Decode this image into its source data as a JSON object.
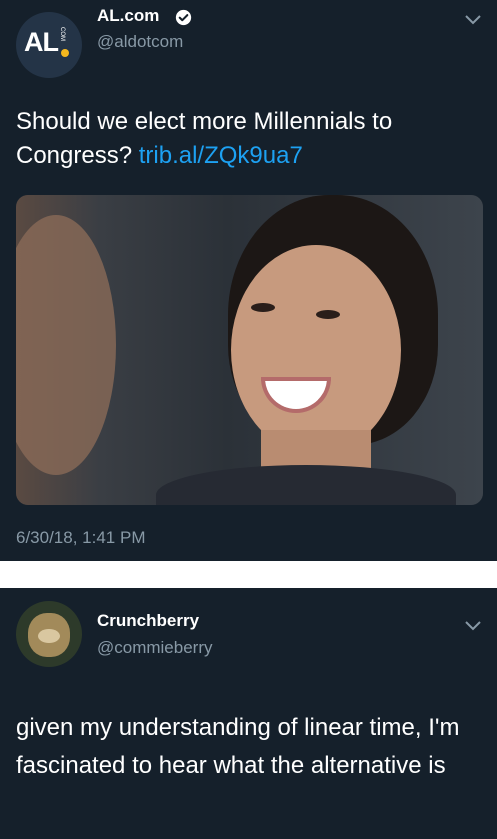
{
  "tweet1": {
    "avatar_text": "AL",
    "avatar_small_text": "COM",
    "name": "AL.com",
    "handle": "@aldotcom",
    "text_before_link": "Should we elect more Millennials to Congress? ",
    "link": "trib.al/ZQk9ua7",
    "timestamp": "6/30/18, 1:41 PM",
    "verified_icon": "verified-check-icon",
    "menu_icon": "chevron-down-icon",
    "colors": {
      "background": "#15202b",
      "link": "#1da1f2",
      "muted": "#8899a6"
    }
  },
  "tweet2": {
    "name": "Crunchberry",
    "handle": "@commieberry",
    "text": "given my understanding of linear time, I'm fascinated to hear what the alternative is",
    "menu_icon": "chevron-down-icon"
  }
}
